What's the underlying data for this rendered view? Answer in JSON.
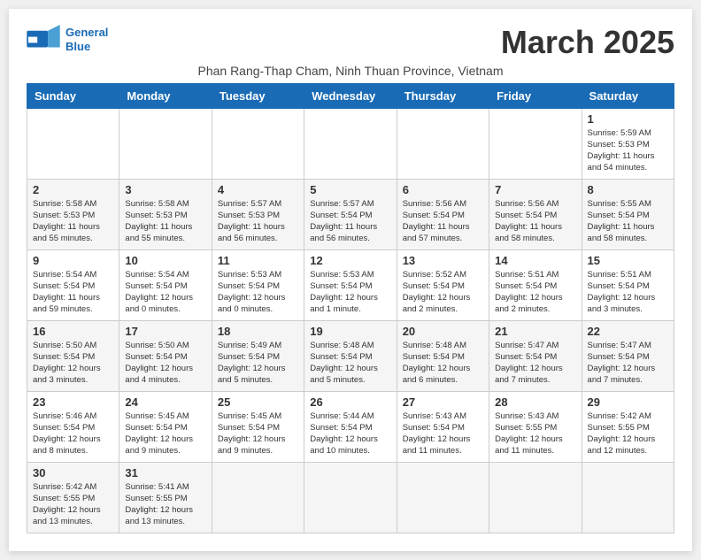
{
  "header": {
    "logo_text_general": "General",
    "logo_text_blue": "Blue",
    "month_title": "March 2025",
    "location": "Phan Rang-Thap Cham, Ninh Thuan Province, Vietnam"
  },
  "weekdays": [
    "Sunday",
    "Monday",
    "Tuesday",
    "Wednesday",
    "Thursday",
    "Friday",
    "Saturday"
  ],
  "weeks": [
    {
      "days": [
        {
          "num": "",
          "info": ""
        },
        {
          "num": "",
          "info": ""
        },
        {
          "num": "",
          "info": ""
        },
        {
          "num": "",
          "info": ""
        },
        {
          "num": "",
          "info": ""
        },
        {
          "num": "",
          "info": ""
        },
        {
          "num": "1",
          "info": "Sunrise: 5:59 AM\nSunset: 5:53 PM\nDaylight: 11 hours\nand 54 minutes."
        }
      ]
    },
    {
      "days": [
        {
          "num": "2",
          "info": "Sunrise: 5:58 AM\nSunset: 5:53 PM\nDaylight: 11 hours\nand 55 minutes."
        },
        {
          "num": "3",
          "info": "Sunrise: 5:58 AM\nSunset: 5:53 PM\nDaylight: 11 hours\nand 55 minutes."
        },
        {
          "num": "4",
          "info": "Sunrise: 5:57 AM\nSunset: 5:53 PM\nDaylight: 11 hours\nand 56 minutes."
        },
        {
          "num": "5",
          "info": "Sunrise: 5:57 AM\nSunset: 5:54 PM\nDaylight: 11 hours\nand 56 minutes."
        },
        {
          "num": "6",
          "info": "Sunrise: 5:56 AM\nSunset: 5:54 PM\nDaylight: 11 hours\nand 57 minutes."
        },
        {
          "num": "7",
          "info": "Sunrise: 5:56 AM\nSunset: 5:54 PM\nDaylight: 11 hours\nand 58 minutes."
        },
        {
          "num": "8",
          "info": "Sunrise: 5:55 AM\nSunset: 5:54 PM\nDaylight: 11 hours\nand 58 minutes."
        }
      ]
    },
    {
      "days": [
        {
          "num": "9",
          "info": "Sunrise: 5:54 AM\nSunset: 5:54 PM\nDaylight: 11 hours\nand 59 minutes."
        },
        {
          "num": "10",
          "info": "Sunrise: 5:54 AM\nSunset: 5:54 PM\nDaylight: 12 hours\nand 0 minutes."
        },
        {
          "num": "11",
          "info": "Sunrise: 5:53 AM\nSunset: 5:54 PM\nDaylight: 12 hours\nand 0 minutes."
        },
        {
          "num": "12",
          "info": "Sunrise: 5:53 AM\nSunset: 5:54 PM\nDaylight: 12 hours\nand 1 minute."
        },
        {
          "num": "13",
          "info": "Sunrise: 5:52 AM\nSunset: 5:54 PM\nDaylight: 12 hours\nand 2 minutes."
        },
        {
          "num": "14",
          "info": "Sunrise: 5:51 AM\nSunset: 5:54 PM\nDaylight: 12 hours\nand 2 minutes."
        },
        {
          "num": "15",
          "info": "Sunrise: 5:51 AM\nSunset: 5:54 PM\nDaylight: 12 hours\nand 3 minutes."
        }
      ]
    },
    {
      "days": [
        {
          "num": "16",
          "info": "Sunrise: 5:50 AM\nSunset: 5:54 PM\nDaylight: 12 hours\nand 3 minutes."
        },
        {
          "num": "17",
          "info": "Sunrise: 5:50 AM\nSunset: 5:54 PM\nDaylight: 12 hours\nand 4 minutes."
        },
        {
          "num": "18",
          "info": "Sunrise: 5:49 AM\nSunset: 5:54 PM\nDaylight: 12 hours\nand 5 minutes."
        },
        {
          "num": "19",
          "info": "Sunrise: 5:48 AM\nSunset: 5:54 PM\nDaylight: 12 hours\nand 5 minutes."
        },
        {
          "num": "20",
          "info": "Sunrise: 5:48 AM\nSunset: 5:54 PM\nDaylight: 12 hours\nand 6 minutes."
        },
        {
          "num": "21",
          "info": "Sunrise: 5:47 AM\nSunset: 5:54 PM\nDaylight: 12 hours\nand 7 minutes."
        },
        {
          "num": "22",
          "info": "Sunrise: 5:47 AM\nSunset: 5:54 PM\nDaylight: 12 hours\nand 7 minutes."
        }
      ]
    },
    {
      "days": [
        {
          "num": "23",
          "info": "Sunrise: 5:46 AM\nSunset: 5:54 PM\nDaylight: 12 hours\nand 8 minutes."
        },
        {
          "num": "24",
          "info": "Sunrise: 5:45 AM\nSunset: 5:54 PM\nDaylight: 12 hours\nand 9 minutes."
        },
        {
          "num": "25",
          "info": "Sunrise: 5:45 AM\nSunset: 5:54 PM\nDaylight: 12 hours\nand 9 minutes."
        },
        {
          "num": "26",
          "info": "Sunrise: 5:44 AM\nSunset: 5:54 PM\nDaylight: 12 hours\nand 10 minutes."
        },
        {
          "num": "27",
          "info": "Sunrise: 5:43 AM\nSunset: 5:54 PM\nDaylight: 12 hours\nand 11 minutes."
        },
        {
          "num": "28",
          "info": "Sunrise: 5:43 AM\nSunset: 5:55 PM\nDaylight: 12 hours\nand 11 minutes."
        },
        {
          "num": "29",
          "info": "Sunrise: 5:42 AM\nSunset: 5:55 PM\nDaylight: 12 hours\nand 12 minutes."
        }
      ]
    },
    {
      "days": [
        {
          "num": "30",
          "info": "Sunrise: 5:42 AM\nSunset: 5:55 PM\nDaylight: 12 hours\nand 13 minutes."
        },
        {
          "num": "31",
          "info": "Sunrise: 5:41 AM\nSunset: 5:55 PM\nDaylight: 12 hours\nand 13 minutes."
        },
        {
          "num": "",
          "info": ""
        },
        {
          "num": "",
          "info": ""
        },
        {
          "num": "",
          "info": ""
        },
        {
          "num": "",
          "info": ""
        },
        {
          "num": "",
          "info": ""
        }
      ]
    }
  ]
}
